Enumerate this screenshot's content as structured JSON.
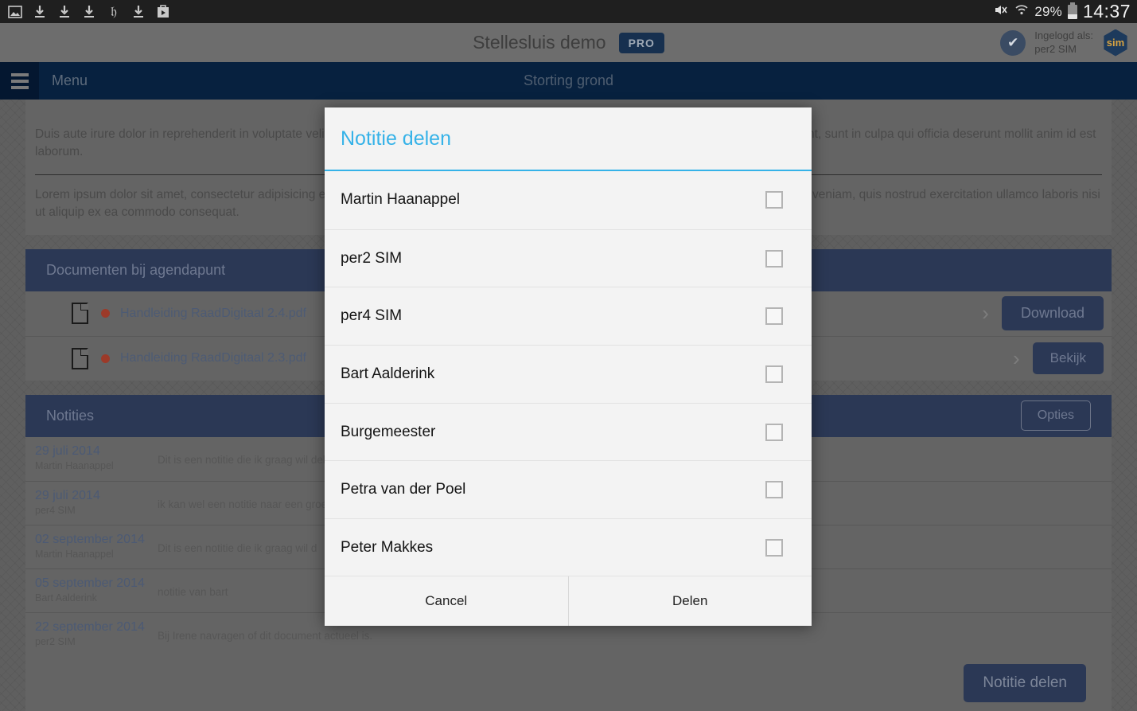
{
  "statusbar": {
    "left_icons": [
      "image-icon",
      "download-icon",
      "download-icon",
      "download-icon",
      "nyt-icon",
      "download-icon",
      "play-store-icon"
    ],
    "mute_icon": "mute-vibrate-icon",
    "wifi_icon": "wifi-icon",
    "battery_percent": "29%",
    "clock": "14:37"
  },
  "appheader": {
    "title": "Stellesluis demo",
    "pro_badge": "PRO",
    "login_label": "Ingelogd als:",
    "login_user": "per2 SIM",
    "logo_text": "sim"
  },
  "navbar": {
    "menu_label": "Menu",
    "page_title": "Storting grond"
  },
  "content": {
    "paragraph1": "Duis aute irure dolor in reprehenderit in voluptate velit esse cillum dolore eu fugiat nulla pariatur. Excepteur sint occaecat cupidatat non proident, sunt in culpa qui officia deserunt mollit anim id est laborum.",
    "paragraph2": "Lorem ipsum dolor sit amet, consectetur adipisicing elit, sed do eiusmod tempor incididunt ut labore et dolore magna aliqua. Ut enim ad minim veniam, quis nostrud exercitation ullamco laboris nisi ut aliquip ex ea commodo consequat.",
    "documents_section": {
      "title": "Documenten bij agendapunt",
      "rows": [
        {
          "name": "Handleiding RaadDigitaal 2.4.pdf",
          "action": "Download"
        },
        {
          "name": "Handleiding RaadDigitaal 2.3.pdf",
          "action": "Bekijk"
        }
      ]
    },
    "notes_section": {
      "title": "Notities",
      "options_label": "Opties",
      "rows": [
        {
          "date": "29 juli 2014",
          "author": "Martin Haanappel",
          "text": "Dit is een notitie die ik graag wil delen me"
        },
        {
          "date": "29 juli 2014",
          "author": "per4 SIM",
          "text": "ik kan wel een notitie naar een groep sturen"
        },
        {
          "date": "02 september 2014",
          "author": "Martin Haanappel",
          "text": "Dit is een notitie die ik graag wil d"
        },
        {
          "date": "05 september 2014",
          "author": "Bart Aalderink",
          "text": "notitie van bart"
        },
        {
          "date": "22 september 2014",
          "author": "per2 SIM",
          "text": "Bij Irene navragen of dit document actueel is."
        }
      ],
      "share_button": "Notitie delen"
    }
  },
  "modal": {
    "title": "Notitie delen",
    "items": [
      {
        "label": "Martin Haanappel",
        "checked": false
      },
      {
        "label": "per2  SIM",
        "checked": false
      },
      {
        "label": "per4 SIM",
        "checked": false
      },
      {
        "label": "Bart Aalderink",
        "checked": false
      },
      {
        "label": "Burgemeester",
        "checked": false
      },
      {
        "label": "Petra van der Poel",
        "checked": false
      },
      {
        "label": "Peter Makkes",
        "checked": false
      }
    ],
    "cancel_label": "Cancel",
    "confirm_label": "Delen"
  },
  "colors": {
    "accent_blue": "#35b2e8",
    "navy": "#07213f",
    "section_navy": "#2b3855",
    "red_dot": "#9c3a29"
  }
}
